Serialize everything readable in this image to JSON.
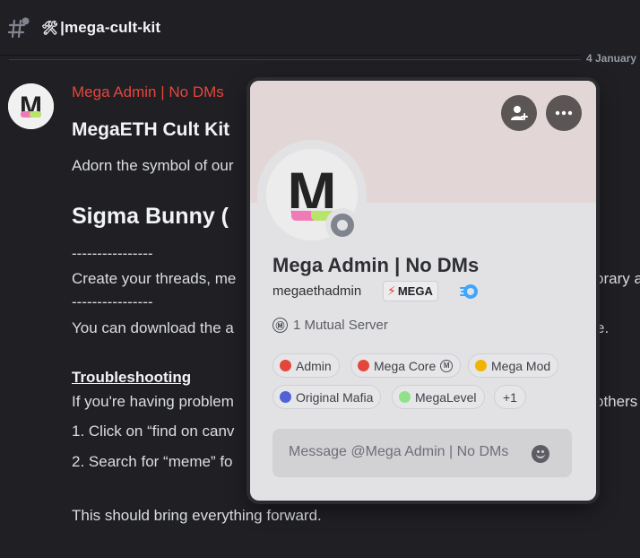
{
  "header": {
    "hash_icon": "threads-hash-icon",
    "channel_emoji": "🛠",
    "channel_name": "|mega-cult-kit"
  },
  "date_divider": "4 January",
  "message": {
    "author": "Mega Admin | No DMs",
    "author_color": "#e5463c",
    "title": "MegaETH Cult Kit",
    "line1": "Adorn the symbol of our",
    "heading": "Sigma Bunny (",
    "dash1": "----------------",
    "line2_left": "Create your threads, me",
    "line2_right": "orary a",
    "dash2": "----------------",
    "line3_left": "You can download the a",
    "line3_right": "e.",
    "subheading": "Troubleshooting",
    "line4_left": "If you're having problem",
    "line4_right": "others",
    "step1": "1. Click on “find on canv",
    "step2": "2. Search for “meme” fo",
    "closing": "This should bring everything forward."
  },
  "profile": {
    "add_friend_icon": "add-friend-icon",
    "more_icon": "more-options-icon",
    "avatar_letter": "M",
    "display_name": "Mega Admin | No DMs",
    "username": "megaethadmin",
    "tag_label": "MEGA",
    "tag_icon": "⚡",
    "nitro_icon": "nitro-badge-icon",
    "mutual_server_icon": "Ⓜ",
    "mutual_servers": "1 Mutual Server",
    "roles": [
      {
        "label": "Admin",
        "color": "#e5463c"
      },
      {
        "label": "Mega Core",
        "color": "#e5463c",
        "extra_icon": "M"
      },
      {
        "label": "Mega Mod",
        "color": "#f0b400"
      },
      {
        "label": "Original Mafia",
        "color": "#4f62d6"
      },
      {
        "label": "MegaLevel",
        "color": "#8ee38a"
      },
      {
        "label": "+1"
      }
    ],
    "message_placeholder": "Message @Mega Admin | No DMs",
    "emoji_icon": "emoji-smile-icon"
  }
}
